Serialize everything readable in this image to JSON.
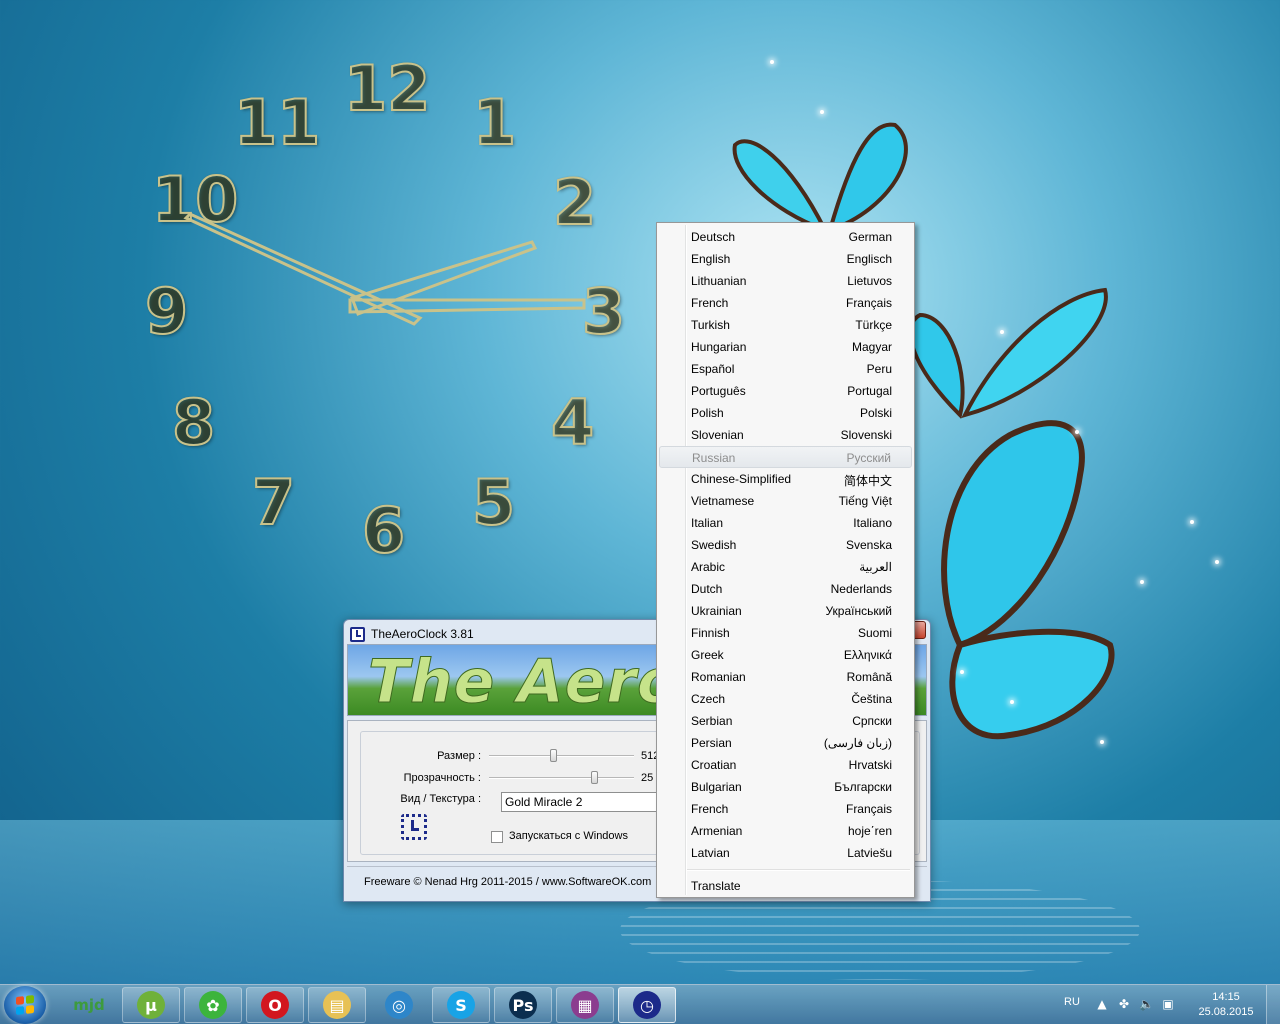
{
  "clock": {
    "numbers": [
      "12",
      "1",
      "2",
      "3",
      "4",
      "5",
      "6",
      "7",
      "8",
      "9",
      "10",
      "11"
    ]
  },
  "app": {
    "title": "TheAeroClock 3.81",
    "banner_text": "The Aero",
    "size_label": "Размер :",
    "size_value": "512",
    "size_level": 0.45,
    "transparency_label": "Прозрачность :",
    "transparency_value": "25 %",
    "transparency_level": 0.75,
    "style_label": "Вид / Текстура :",
    "style_value": "Gold Miracle 2",
    "autostart_label": "Запускаться с Windows",
    "autostart_checked": false,
    "footer": "Freeware © Nenad Hrg 2011-2015 / www.SoftwareOK.com"
  },
  "menu": {
    "items": [
      {
        "left": "Deutsch",
        "right": "German"
      },
      {
        "left": "English",
        "right": "Englisch"
      },
      {
        "left": "Lithuanian",
        "right": "Lietuvos"
      },
      {
        "left": "French",
        "right": "Français"
      },
      {
        "left": "Turkish",
        "right": "Türkçe"
      },
      {
        "left": "Hungarian",
        "right": "Magyar"
      },
      {
        "left": "Español",
        "right": "Peru"
      },
      {
        "left": "Português",
        "right": "Portugal"
      },
      {
        "left": "Polish",
        "right": "Polski"
      },
      {
        "left": "Slovenian",
        "right": "Slovenski"
      },
      {
        "left": "Russian",
        "right": "Русский",
        "disabled": true
      },
      {
        "left": "Chinese-Simplified",
        "right": "简体中文"
      },
      {
        "left": "Vietnamese",
        "right": "Tiếng Việt"
      },
      {
        "left": "Italian",
        "right": "Italiano"
      },
      {
        "left": "Swedish",
        "right": "Svenska"
      },
      {
        "left": "Arabic",
        "right": "العربية"
      },
      {
        "left": "Dutch",
        "right": "Nederlands"
      },
      {
        "left": "Ukrainian",
        "right": "Український"
      },
      {
        "left": "Finnish",
        "right": "Suomi"
      },
      {
        "left": "Greek",
        "right": "Ελληνικά"
      },
      {
        "left": "Romanian",
        "right": "Română"
      },
      {
        "left": "Czech",
        "right": "Čeština"
      },
      {
        "left": "Serbian",
        "right": "Српски"
      },
      {
        "left": "Persian",
        "right": "(زبان فارسی)"
      },
      {
        "left": "Croatian",
        "right": "Hrvatski"
      },
      {
        "left": "Bulgarian",
        "right": "Български"
      },
      {
        "left": "French",
        "right": "Français"
      },
      {
        "left": "Armenian",
        "right": "hoje΄ren"
      },
      {
        "left": "Latvian",
        "right": "Latviešu"
      }
    ],
    "translate_label": "Translate"
  },
  "taskbar": {
    "apps": [
      {
        "name": "mjd",
        "icon": "mjd-icon",
        "glyph": "mjd",
        "color": "#3d9b3d"
      },
      {
        "name": "utorrent",
        "icon": "utorrent-icon",
        "glyph": "µ",
        "color": "#6fb13a"
      },
      {
        "name": "icq",
        "icon": "icq-flower-icon",
        "glyph": "✿",
        "color": "#3cb43c"
      },
      {
        "name": "opera",
        "icon": "opera-icon",
        "glyph": "O",
        "color": "#d2161f"
      },
      {
        "name": "explorer",
        "icon": "folder-icon",
        "glyph": "▤",
        "color": "#e7c155"
      },
      {
        "name": "qip",
        "icon": "qip-icon",
        "glyph": "◎",
        "color": "#2e86c9"
      },
      {
        "name": "skype",
        "icon": "skype-icon",
        "glyph": "S",
        "color": "#18a3e6"
      },
      {
        "name": "photoshop",
        "icon": "photoshop-icon",
        "glyph": "Ps",
        "color": "#0b2e4f"
      },
      {
        "name": "winrar",
        "icon": "winrar-icon",
        "glyph": "▦",
        "color": "#8b3d8f"
      },
      {
        "name": "theaeroclock",
        "icon": "clock-icon",
        "glyph": "◷",
        "color": "#1c2a8a"
      }
    ],
    "language": "RU",
    "time": "14:15",
    "date": "25.08.2015"
  }
}
